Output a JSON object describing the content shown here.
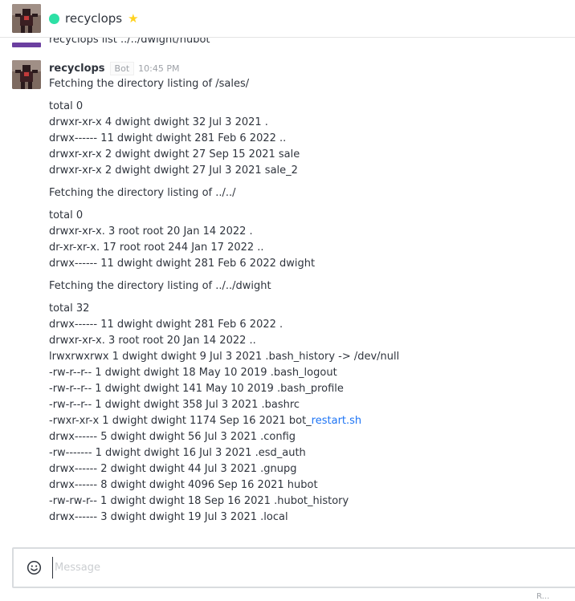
{
  "header": {
    "room_name": "recyclops",
    "status_color": "#2de0a5",
    "star_color": "#ffd21f",
    "icons": {
      "room_avatar": "avatar-icon",
      "star": "star-icon"
    }
  },
  "previous_message": {
    "text": "recyclops list ../../dwight/hubot",
    "accent_color": "#6b3fa0"
  },
  "message": {
    "username": "recyclops",
    "badge": "Bot",
    "timestamp": "10:45 PM",
    "intro": "Fetching the directory listing of /sales/",
    "block1": [
      "total 0",
      "drwxr-xr-x 4 dwight dwight 32 Jul 3 2021 .",
      "drwx------ 11 dwight dwight 281 Feb 6 2022 ..",
      "drwxr-xr-x 2 dwight dwight 27 Sep 15 2021 sale",
      "drwxr-xr-x 2 dwight dwight 27 Jul 3 2021 sale_2"
    ],
    "fetch2": "Fetching the directory listing of ../../",
    "block2": [
      "total 0",
      "drwxr-xr-x. 3 root root 20 Jan 14 2022 .",
      "dr-xr-xr-x. 17 root root 244 Jan 17 2022 ..",
      "drwx------ 11 dwight dwight 281 Feb 6 2022 dwight"
    ],
    "fetch3": "Fetching the directory listing of ../../dwight",
    "block3_before_link": [
      "total 32",
      "drwx------ 11 dwight dwight 281 Feb 6 2022 .",
      "drwxr-xr-x. 3 root root 20 Jan 14 2022 ..",
      "lrwxrwxrwx 1 dwight dwight 9 Jul 3 2021 .bash_history -> /dev/null",
      "-rw-r--r-- 1 dwight dwight 18 May 10 2019 .bash_logout",
      "-rw-r--r-- 1 dwight dwight 141 May 10 2019 .bash_profile",
      "-rw-r--r-- 1 dwight dwight 358 Jul 3 2021 .bashrc"
    ],
    "link_line_prefix": "-rwxr-xr-x 1 dwight dwight 1174 Sep 16 2021 bot_",
    "link_text": "restart.sh",
    "link_color": "#1d74f5",
    "block3_after_link": [
      "drwx------ 5 dwight dwight 56 Jul 3 2021 .config",
      "-rw------- 1 dwight dwight 16 Jul 3 2021 .esd_auth",
      "drwx------ 2 dwight dwight 44 Jul 3 2021 .gnupg",
      "drwx------ 8 dwight dwight 4096 Sep 16 2021 hubot",
      "-rw-rw-r-- 1 dwight dwight 18 Sep 16 2021 .hubot_history",
      "drwx------ 3 dwight dwight 19 Jul 3 2021 .local"
    ]
  },
  "composer": {
    "placeholder": "Message",
    "value": "",
    "emoji_icon": "smiley-icon"
  },
  "footer_hint": "R..."
}
